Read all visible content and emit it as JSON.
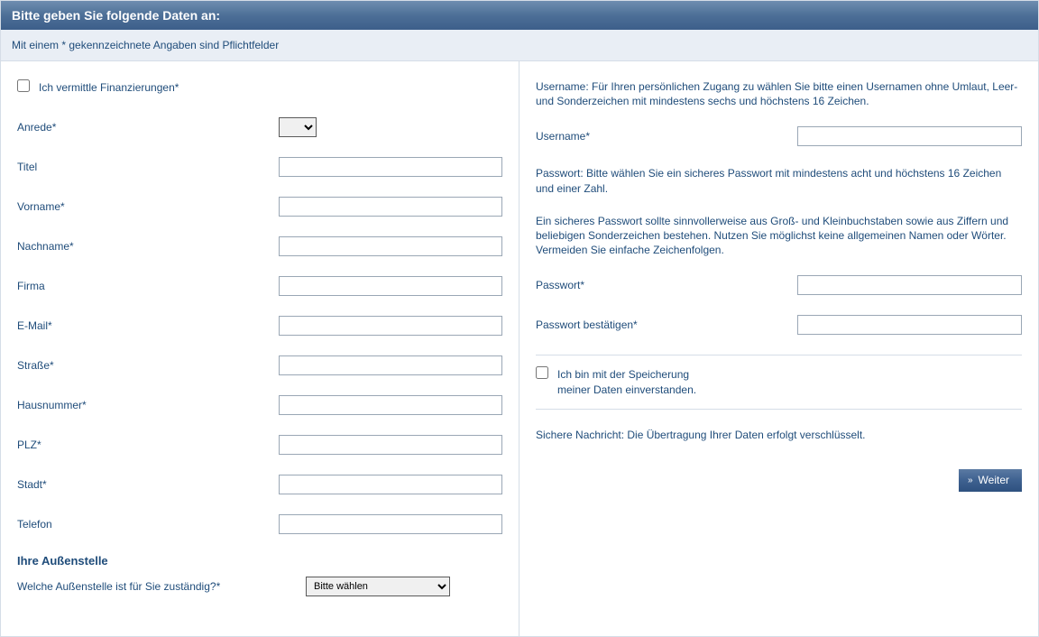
{
  "header": {
    "title": "Bitte geben Sie folgende Daten an:"
  },
  "subheader": {
    "text": "Mit einem * gekennzeichnete Angaben sind Pflichtfelder"
  },
  "left": {
    "finance_cb_label": "Ich vermittle Finanzierungen*",
    "salutation_label": "Anrede*",
    "title_label": "Titel",
    "firstname_label": "Vorname*",
    "lastname_label": "Nachname*",
    "company_label": "Firma",
    "email_label": "E-Mail*",
    "street_label": "Straße*",
    "houseno_label": "Hausnummer*",
    "zip_label": "PLZ*",
    "city_label": "Stadt*",
    "phone_label": "Telefon",
    "branch_section_title": "Ihre Außenstelle",
    "branch_question": "Welche Außenstelle ist für Sie zuständig?*",
    "branch_select_placeholder": "Bitte wählen"
  },
  "right": {
    "username_info": "Username: Für Ihren persönlichen Zugang zu wählen Sie bitte einen Usernamen ohne Umlaut, Leer- und Sonderzeichen mit mindestens sechs und höchstens 16 Zeichen.",
    "username_label": "Username*",
    "password_info1": "Passwort: Bitte wählen Sie ein sicheres Passwort mit mindestens acht und höchstens 16 Zeichen und einer Zahl.",
    "password_info2": "Ein sicheres Passwort sollte sinnvollerweise aus Groß- und Kleinbuchstaben sowie aus Ziffern und beliebigen Sonderzeichen bestehen. Nutzen Sie möglichst keine allgemeinen Namen oder Wörter. Vermeiden Sie einfache Zeichenfolgen.",
    "password_label": "Passwort*",
    "password_confirm_label": "Passwort bestätigen*",
    "consent_line1": "Ich bin mit der Speicherung",
    "consent_line2": "meiner Daten einverstanden.",
    "secure_msg": "Sichere Nachricht: Die Übertragung Ihrer Daten erfolgt verschlüsselt.",
    "submit_label": "Weiter"
  }
}
